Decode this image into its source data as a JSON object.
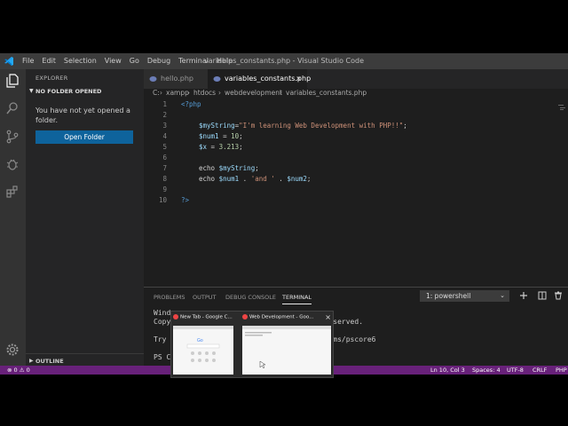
{
  "titlebar": {
    "menu": [
      "File",
      "Edit",
      "Selection",
      "View",
      "Go",
      "Debug",
      "Terminal",
      "Help"
    ],
    "window_title": "variables_constants.php - Visual Studio Code"
  },
  "sidebar": {
    "header": "EXPLORER",
    "section": "NO FOLDER OPENED",
    "message": "You have not yet opened a folder.",
    "open_button": "Open Folder",
    "outline": "OUTLINE"
  },
  "tabs": [
    {
      "label": "hello.php"
    },
    {
      "label": "variables_constants.php",
      "close": "×"
    }
  ],
  "breadcrumb": {
    "parts": [
      "C:",
      "xampp",
      "htdocs",
      "webdevelopment",
      "variables_constants.php"
    ],
    "separator": "›"
  },
  "code_lines": [
    {
      "n": "1",
      "segments": [
        {
          "t": "tag",
          "v": "<?php"
        }
      ]
    },
    {
      "n": "2",
      "segments": []
    },
    {
      "n": "3",
      "segments": [
        {
          "t": "var",
          "v": "$myString"
        },
        {
          "t": "plain",
          "v": "="
        },
        {
          "t": "str",
          "v": "\"I'm learning Web Development with PHP!!\""
        },
        {
          "t": "plain",
          "v": ";"
        }
      ]
    },
    {
      "n": "4",
      "segments": [
        {
          "t": "var",
          "v": "$num1"
        },
        {
          "t": "plain",
          "v": " = "
        },
        {
          "t": "num",
          "v": "10"
        },
        {
          "t": "plain",
          "v": ";"
        }
      ]
    },
    {
      "n": "5",
      "segments": [
        {
          "t": "var",
          "v": "$x"
        },
        {
          "t": "plain",
          "v": " = "
        },
        {
          "t": "num",
          "v": "3.213"
        },
        {
          "t": "plain",
          "v": ";"
        }
      ]
    },
    {
      "n": "6",
      "segments": []
    },
    {
      "n": "7",
      "segments": [
        {
          "t": "plain",
          "v": "echo "
        },
        {
          "t": "var",
          "v": "$myString"
        },
        {
          "t": "plain",
          "v": ";"
        }
      ]
    },
    {
      "n": "8",
      "segments": [
        {
          "t": "plain",
          "v": "echo "
        },
        {
          "t": "var",
          "v": "$num1"
        },
        {
          "t": "plain",
          "v": " . "
        },
        {
          "t": "str",
          "v": "'and '"
        },
        {
          "t": "plain",
          "v": " . "
        },
        {
          "t": "var",
          "v": "$num2"
        },
        {
          "t": "plain",
          "v": ";"
        }
      ]
    },
    {
      "n": "9",
      "segments": []
    },
    {
      "n": "10",
      "segments": [
        {
          "t": "tag",
          "v": "?>"
        }
      ]
    }
  ],
  "panel": {
    "tabs": [
      "PROBLEMS",
      "OUTPUT",
      "DEBUG CONSOLE",
      "TERMINAL"
    ],
    "active_tab": "TERMINAL",
    "terminal_select": "1: powershell",
    "terminal_lines": [
      "Wind",
      "Copy                                 ts reserved.",
      "",
      "Try                                  /aka.ms/pscore6",
      "",
      "PS C"
    ]
  },
  "taskbar_preview": [
    {
      "title": "New Tab - Google C..."
    },
    {
      "title": "Web Development - Goo..."
    }
  ],
  "preview_close": "×",
  "status_bar": {
    "problems": "⊗ 0  ⚠ 0",
    "position": "Ln 10, Col 3",
    "spaces": "Spaces: 4",
    "encoding": "UTF-8",
    "eol": "CRLF",
    "language": "PHP"
  },
  "colors": {
    "accent_blue": "#0e639c",
    "status_purple": "#68217a"
  }
}
